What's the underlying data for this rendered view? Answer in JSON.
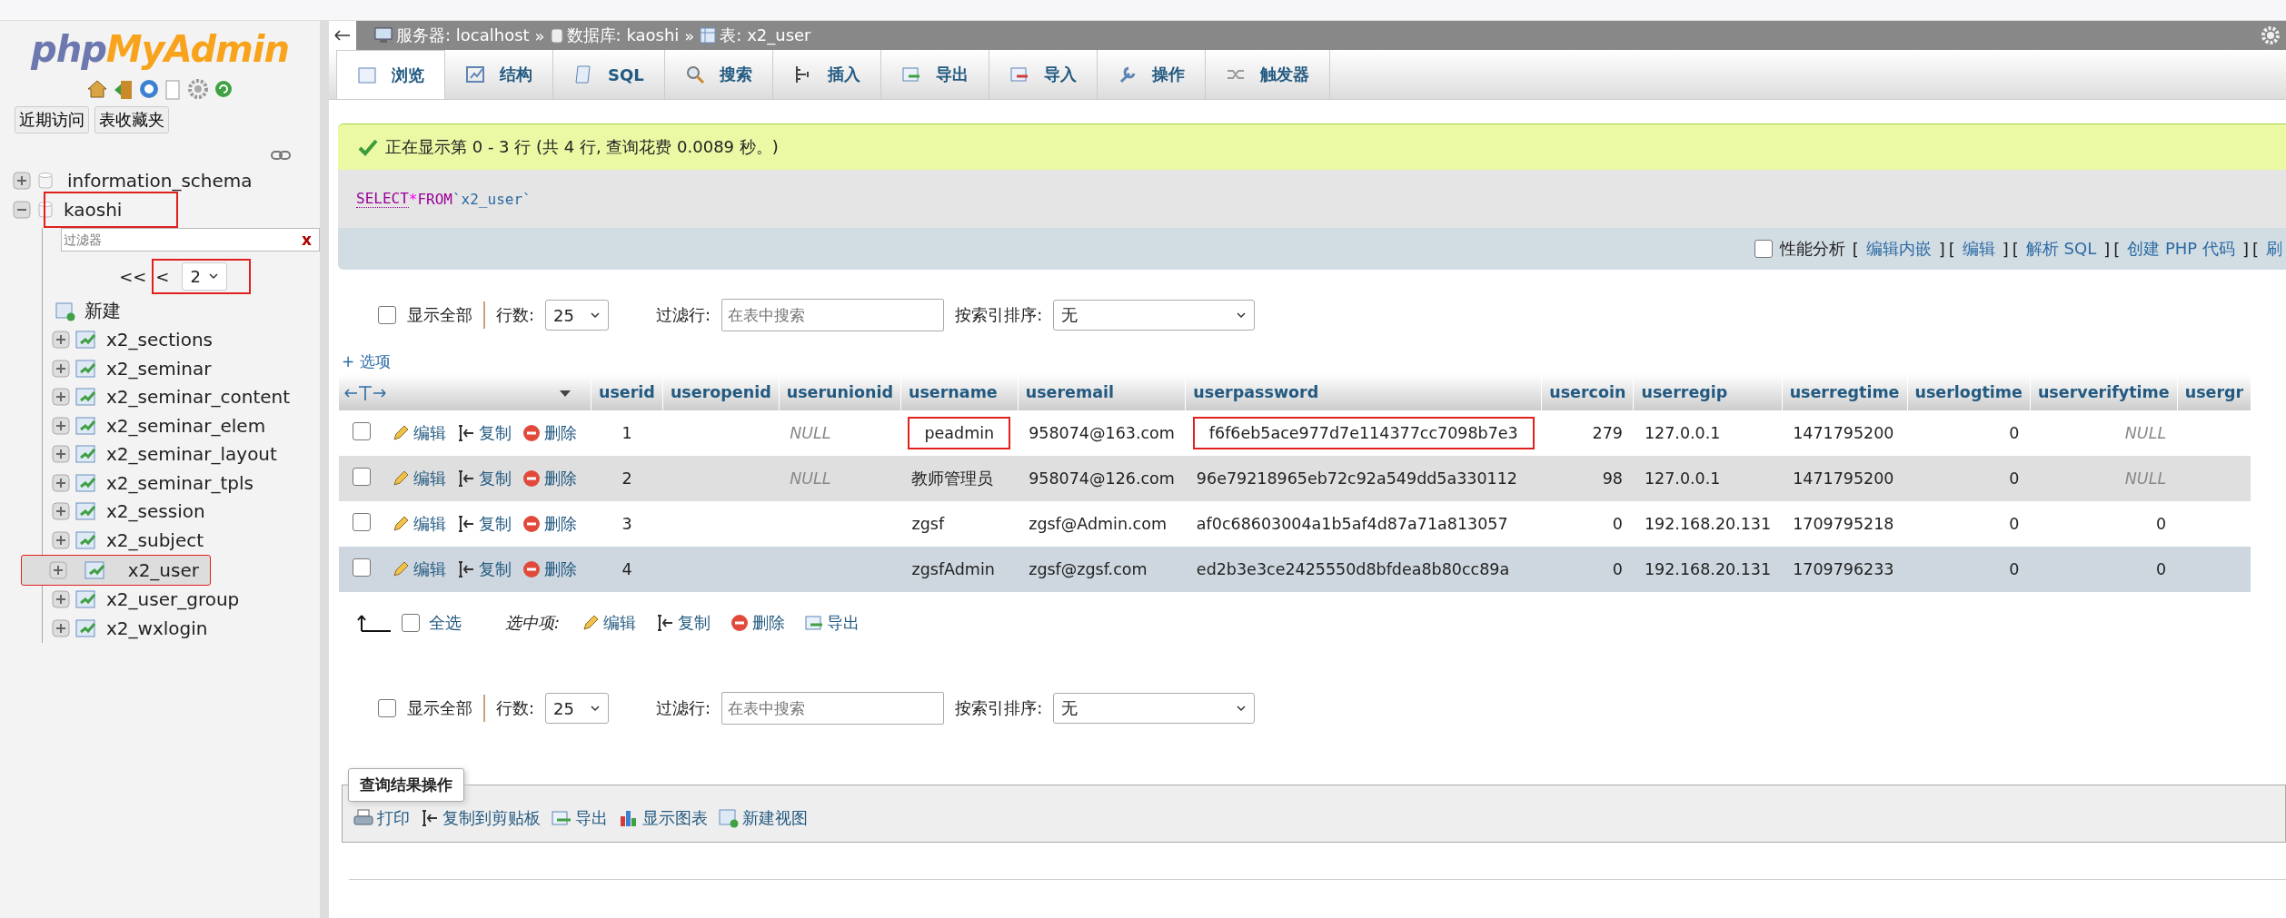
{
  "sidebar": {
    "logo_left": "php",
    "logo_right": "MyAdmin",
    "buttons": [
      {
        "label": "近期访问"
      },
      {
        "label": "表收藏夹"
      }
    ],
    "databases": [
      {
        "name": "information_schema",
        "expanded": false,
        "highlighted": false
      },
      {
        "name": "kaoshi",
        "expanded": true,
        "highlighted": true,
        "filter_placeholder": "过滤器",
        "filter_clear": "x",
        "pager": {
          "first": "<<",
          "prev": "<",
          "page": "2",
          "highlighted": true
        },
        "new_label": "新建",
        "children": [
          {
            "name": "x2_sections",
            "selected": false,
            "highlighted": false
          },
          {
            "name": "x2_seminar",
            "selected": false,
            "highlighted": false
          },
          {
            "name": "x2_seminar_content",
            "selected": false,
            "highlighted": false
          },
          {
            "name": "x2_seminar_elem",
            "selected": false,
            "highlighted": false
          },
          {
            "name": "x2_seminar_layout",
            "selected": false,
            "highlighted": false
          },
          {
            "name": "x2_seminar_tpls",
            "selected": false,
            "highlighted": false
          },
          {
            "name": "x2_session",
            "selected": false,
            "highlighted": false
          },
          {
            "name": "x2_subject",
            "selected": false,
            "highlighted": false
          },
          {
            "name": "x2_user",
            "selected": true,
            "highlighted": true
          },
          {
            "name": "x2_user_group",
            "selected": false,
            "highlighted": false
          },
          {
            "name": "x2_wxlogin",
            "selected": false,
            "highlighted": false
          }
        ]
      }
    ]
  },
  "breadcrumb": [
    {
      "text": "服务器: localhost",
      "kind": "server"
    },
    {
      "text": "数据库: kaoshi",
      "kind": "database"
    },
    {
      "text": "表: x2_user",
      "kind": "table"
    }
  ],
  "breadcrumb_sep": "»",
  "tabs": [
    {
      "label": "浏览",
      "selected": true
    },
    {
      "label": "结构",
      "selected": false
    },
    {
      "label": "SQL",
      "selected": false
    },
    {
      "label": "搜索",
      "selected": false
    },
    {
      "label": "插入",
      "selected": false
    },
    {
      "label": "导出",
      "selected": false
    },
    {
      "label": "导入",
      "selected": false
    },
    {
      "label": "操作",
      "selected": false
    },
    {
      "label": "触发器",
      "selected": false
    }
  ],
  "message": "正在显示第 0 - 3 行 (共 4 行, 查询花费 0.0089 秒。)",
  "sql": {
    "keyword1": "SELECT",
    "star": "*",
    "keyword2": "FROM",
    "table": "`x2_user`"
  },
  "query_options": {
    "profiling_label": "性能分析",
    "profiling_checked": false,
    "links": [
      {
        "open": "[",
        "text": "编辑内嵌",
        "close": "]"
      },
      {
        "open": "[",
        "text": "编辑",
        "close": "]"
      },
      {
        "open": "[",
        "text": "解析 SQL",
        "close": "]"
      },
      {
        "open": "[",
        "text": "创建 PHP 代码",
        "close": "]"
      },
      {
        "open": "[",
        "text": "刷"
      }
    ]
  },
  "nav_controls": {
    "show_all": "显示全部",
    "show_all_checked": false,
    "rows_label": "行数:",
    "rows_value": "25",
    "filter_label": "过滤行:",
    "filter_placeholder": "在表中搜索",
    "sort_label": "按索引排序:",
    "sort_value": "无"
  },
  "options_link": "+ 选项",
  "table": {
    "columns": [
      "userid",
      "useropenid",
      "userunionid",
      "username",
      "useremail",
      "userpassword",
      "usercoin",
      "userregip",
      "userregtime",
      "userlogtime",
      "userverifytime",
      "usergr"
    ],
    "rows": [
      {
        "checked": false,
        "hover": false,
        "actions": [
          "编辑",
          "复制",
          "删除"
        ],
        "cells": [
          "1",
          "",
          {
            "text": "NULL",
            "kind": "null"
          },
          {
            "text": "peadmin",
            "highlighted": true
          },
          "958074@163.com",
          {
            "text": "f6f6eb5ace977d7e114377cc7098b7e3",
            "highlighted": true
          },
          "279",
          "127.0.0.1",
          "1471795200",
          "0",
          {
            "text": "NULL",
            "kind": "null"
          },
          ""
        ]
      },
      {
        "checked": false,
        "hover": false,
        "actions": [
          "编辑",
          "复制",
          "删除"
        ],
        "cells": [
          "2",
          "",
          {
            "text": "NULL",
            "kind": "null"
          },
          "教师管理员",
          "958074@126.com",
          "96e79218965eb72c92a549dd5a330112",
          "98",
          "127.0.0.1",
          "1471795200",
          "0",
          {
            "text": "NULL",
            "kind": "null"
          },
          ""
        ]
      },
      {
        "checked": false,
        "hover": false,
        "actions": [
          "编辑",
          "复制",
          "删除"
        ],
        "cells": [
          "3",
          "",
          "",
          "zgsf",
          "zgsf@Admin.com",
          "af0c68603004a1b5af4d87a71a813057",
          "0",
          "192.168.20.131",
          "1709795218",
          "0",
          "0",
          ""
        ]
      },
      {
        "checked": false,
        "hover": true,
        "actions": [
          "编辑",
          "复制",
          "删除"
        ],
        "cells": [
          "4",
          "",
          "",
          "zgsfAdmin",
          "zgsf@zgsf.com",
          "ed2b3e3ce2425550d8bfdea8b80cc89a",
          "0",
          "192.168.20.131",
          "1709796233",
          "0",
          "0",
          ""
        ]
      }
    ]
  },
  "bulk": {
    "check_all": "全选",
    "checked": false,
    "with_selected": "选中项:",
    "actions": [
      {
        "label": "编辑"
      },
      {
        "label": "复制"
      },
      {
        "label": "删除"
      },
      {
        "label": "导出"
      }
    ]
  },
  "nav_controls_bottom": {
    "show_all": "显示全部",
    "show_all_checked": false,
    "rows_label": "行数:",
    "rows_value": "25",
    "filter_label": "过滤行:",
    "filter_placeholder": "在表中搜索",
    "sort_label": "按索引排序:",
    "sort_value": "无"
  },
  "result_ops": {
    "legend": "查询结果操作",
    "actions": [
      {
        "label": "打印"
      },
      {
        "label": "复制到剪贴板"
      },
      {
        "label": "导出"
      },
      {
        "label": "显示图表"
      },
      {
        "label": "新建视图"
      }
    ]
  }
}
